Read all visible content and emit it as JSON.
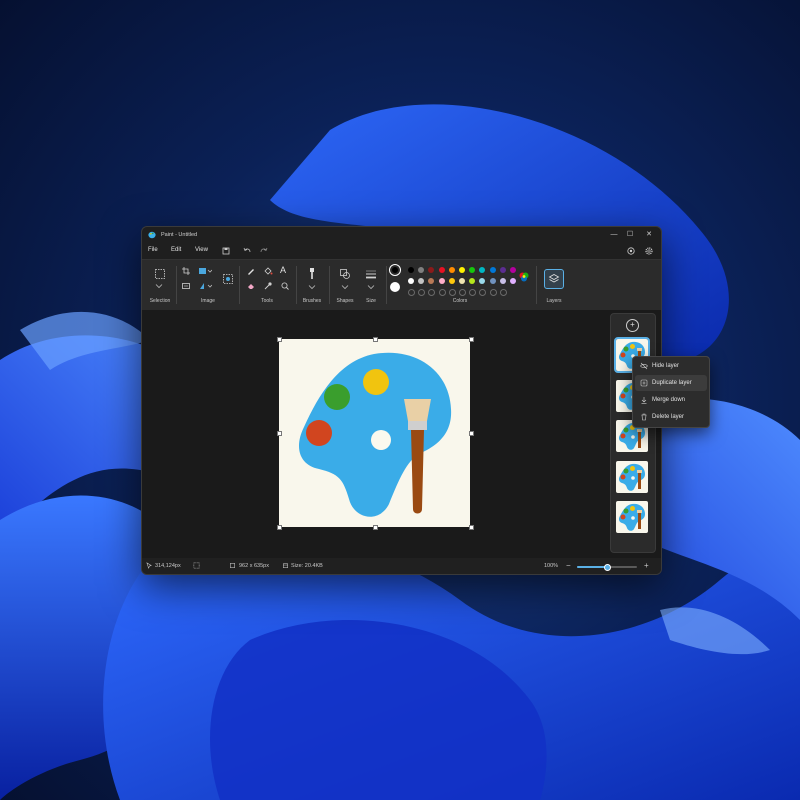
{
  "window": {
    "title": "Paint - Untitled",
    "controls": {
      "minimize": "—",
      "maximize": "☐",
      "close": "✕"
    }
  },
  "menu": {
    "items": [
      "File",
      "Edit",
      "View"
    ]
  },
  "ribbon": {
    "groups": {
      "selection": "Selection",
      "image": "Image",
      "tools": "Tools",
      "brushes": "Brushes",
      "shapes": "Shapes",
      "size": "Size",
      "colors": "Colors",
      "layers": "Layers"
    },
    "text_tool": "A",
    "palette_row1": [
      "#000000",
      "#7f7f7f",
      "#8b1a1a",
      "#e81123",
      "#ff8c00",
      "#fff100",
      "#16c60c",
      "#00b7c3",
      "#0078d7",
      "#5c2d91",
      "#b4009e"
    ],
    "palette_row2": [
      "#ffffff",
      "#c3c3c3",
      "#b97a57",
      "#ffaec9",
      "#ffc90e",
      "#efe4b0",
      "#b5e61d",
      "#99d9ea",
      "#7092be",
      "#c8bfe7",
      "#e0b0ff"
    ],
    "primary_color": "#000000",
    "secondary_color": "#ffffff"
  },
  "context_menu": {
    "items": [
      {
        "label": "Hide layer",
        "icon": "eye-off-icon"
      },
      {
        "label": "Duplicate layer",
        "icon": "duplicate-icon"
      },
      {
        "label": "Merge down",
        "icon": "merge-down-icon"
      },
      {
        "label": "Delete layer",
        "icon": "trash-icon"
      }
    ]
  },
  "layers": {
    "add_label": "+",
    "count": 5
  },
  "status": {
    "cursor_position": "314,124px",
    "canvas_size": "962  x  635px",
    "file_size": "Size: 20.4KB",
    "zoom": "100%",
    "zoom_out": "−",
    "zoom_in": "+",
    "zoom_level": 0.5
  }
}
